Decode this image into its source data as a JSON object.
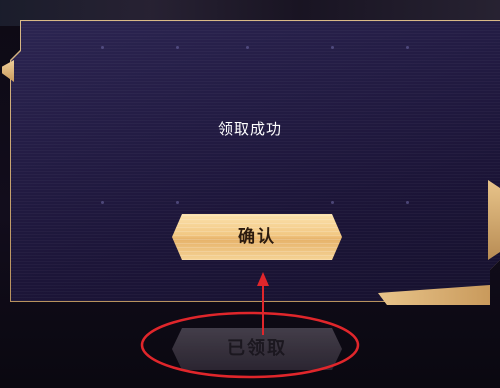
{
  "dialog": {
    "message": "领取成功",
    "confirm_label": "确认"
  },
  "background_button": {
    "claimed_label": "已领取"
  },
  "annotation": {
    "color": "#e0262b"
  },
  "colors": {
    "dialog_bg": "#231c44",
    "gold_accent": "#e8c48a",
    "button_text": "#2b1a0e"
  }
}
